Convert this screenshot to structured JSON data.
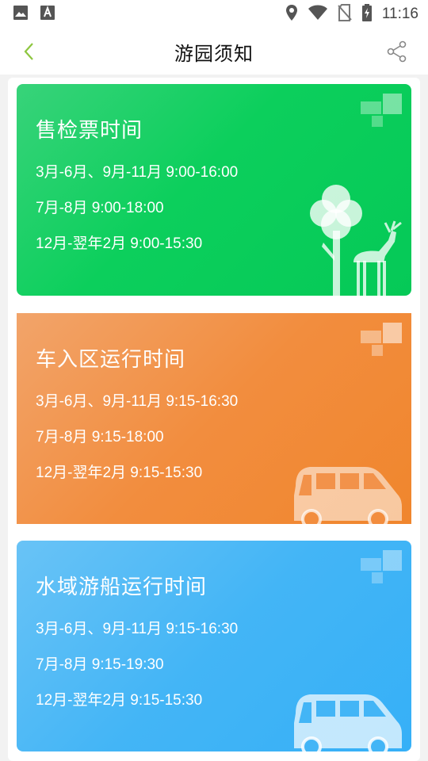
{
  "status_bar": {
    "time": "11:16",
    "icons": [
      "image-icon",
      "font-icon",
      "location-icon",
      "wifi-icon",
      "no-sim-icon",
      "battery-charging-icon"
    ]
  },
  "header": {
    "title": "游园须知",
    "back_icon": "chevron-left-icon",
    "share_icon": "share-icon",
    "accent": "#8dc63f"
  },
  "cards": [
    {
      "title": "售检票时间",
      "lines": [
        "3月-6月、9月-11月 9:00-16:00",
        "7月-8月 9:00-18:00",
        "12月-翌年2月 9:00-15:30"
      ],
      "color": "#0ccf5c",
      "illustration": "tree-deer-icon"
    },
    {
      "title": "车入区运行时间",
      "lines": [
        "3月-6月、9月-11月 9:15-16:30",
        "7月-8月 9:15-18:00",
        "12月-翌年2月 9:15-15:30"
      ],
      "color": "#f28d3e",
      "illustration": "van-icon"
    },
    {
      "title": "水域游船运行时间",
      "lines": [
        "3月-6月、9月-11月 9:15-16:30",
        "7月-8月 9:15-19:30",
        "12月-翌年2月 9:15-15:30"
      ],
      "color": "#43b5f6",
      "illustration": "van-icon"
    }
  ]
}
